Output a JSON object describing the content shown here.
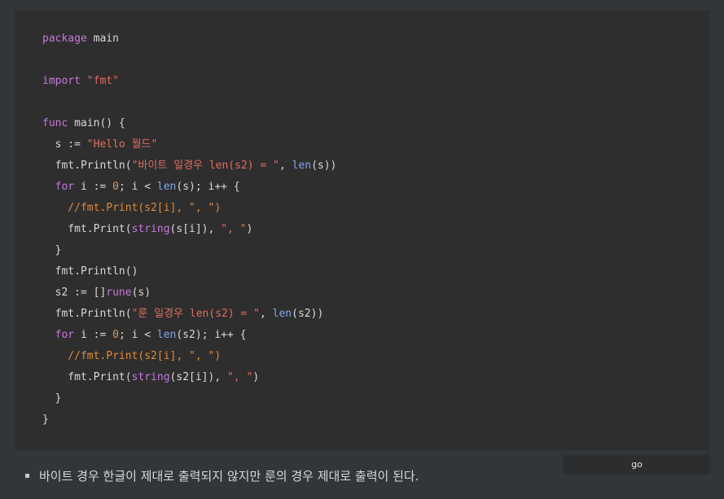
{
  "code_block": {
    "language": "go",
    "lines": [
      [
        {
          "t": "package",
          "c": "kw"
        },
        {
          "t": " main",
          "c": "plain"
        }
      ],
      [],
      [
        {
          "t": "import",
          "c": "kw"
        },
        {
          "t": " ",
          "c": "plain"
        },
        {
          "t": "\"fmt\"",
          "c": "str"
        }
      ],
      [],
      [
        {
          "t": "func",
          "c": "kw"
        },
        {
          "t": " main() {",
          "c": "plain"
        }
      ],
      [
        {
          "t": "  s := ",
          "c": "plain"
        },
        {
          "t": "\"Hello 월드\"",
          "c": "str"
        }
      ],
      [
        {
          "t": "  fmt.Println(",
          "c": "plain"
        },
        {
          "t": "\"바이트 일경우 len(s2) = \"",
          "c": "str"
        },
        {
          "t": ", ",
          "c": "plain"
        },
        {
          "t": "len",
          "c": "fn"
        },
        {
          "t": "(s))",
          "c": "plain"
        }
      ],
      [
        {
          "t": "  ",
          "c": "plain"
        },
        {
          "t": "for",
          "c": "kw"
        },
        {
          "t": " i := ",
          "c": "plain"
        },
        {
          "t": "0",
          "c": "num"
        },
        {
          "t": "; i < ",
          "c": "plain"
        },
        {
          "t": "len",
          "c": "fn"
        },
        {
          "t": "(s); i++ {",
          "c": "plain"
        }
      ],
      [
        {
          "t": "    //fmt.Print(s2[i], \", \")",
          "c": "cmt"
        }
      ],
      [
        {
          "t": "    fmt.Print(",
          "c": "plain"
        },
        {
          "t": "string",
          "c": "kw"
        },
        {
          "t": "(s[i]), ",
          "c": "plain"
        },
        {
          "t": "\", \"",
          "c": "str"
        },
        {
          "t": ")",
          "c": "plain"
        }
      ],
      [
        {
          "t": "  }",
          "c": "plain"
        }
      ],
      [
        {
          "t": "  fmt.Println()",
          "c": "plain"
        }
      ],
      [
        {
          "t": "  s2 := []",
          "c": "plain"
        },
        {
          "t": "rune",
          "c": "kw"
        },
        {
          "t": "(s)",
          "c": "plain"
        }
      ],
      [
        {
          "t": "  fmt.Println(",
          "c": "plain"
        },
        {
          "t": "\"룬 일경우 len(s2) = \"",
          "c": "str"
        },
        {
          "t": ", ",
          "c": "plain"
        },
        {
          "t": "len",
          "c": "fn"
        },
        {
          "t": "(s2))",
          "c": "plain"
        }
      ],
      [
        {
          "t": "  ",
          "c": "plain"
        },
        {
          "t": "for",
          "c": "kw"
        },
        {
          "t": " i := ",
          "c": "plain"
        },
        {
          "t": "0",
          "c": "num"
        },
        {
          "t": "; i < ",
          "c": "plain"
        },
        {
          "t": "len",
          "c": "fn"
        },
        {
          "t": "(s2); i++ {",
          "c": "plain"
        }
      ],
      [
        {
          "t": "    //fmt.Print(s2[i], \", \")",
          "c": "cmt"
        }
      ],
      [
        {
          "t": "    fmt.Print(",
          "c": "plain"
        },
        {
          "t": "string",
          "c": "kw"
        },
        {
          "t": "(s2[i]), ",
          "c": "plain"
        },
        {
          "t": "\", \"",
          "c": "str"
        },
        {
          "t": ")",
          "c": "plain"
        }
      ],
      [
        {
          "t": "  }",
          "c": "plain"
        }
      ],
      [
        {
          "t": "}",
          "c": "plain"
        }
      ]
    ]
  },
  "colors": {
    "page_background": "#323639",
    "code_background": "#2e2e2e",
    "keyword": "#c678dd",
    "string": "#e06c60",
    "number": "#d19a66",
    "builtin": "#7fa6e8",
    "comment": "#e08a3a",
    "text": "#d8d8d8"
  },
  "go_label": "go",
  "bullet_items": [
    "바이트 경우 한글이 제대로 출력되지 않지만 룬의 경우 제대로 출력이 된다."
  ]
}
